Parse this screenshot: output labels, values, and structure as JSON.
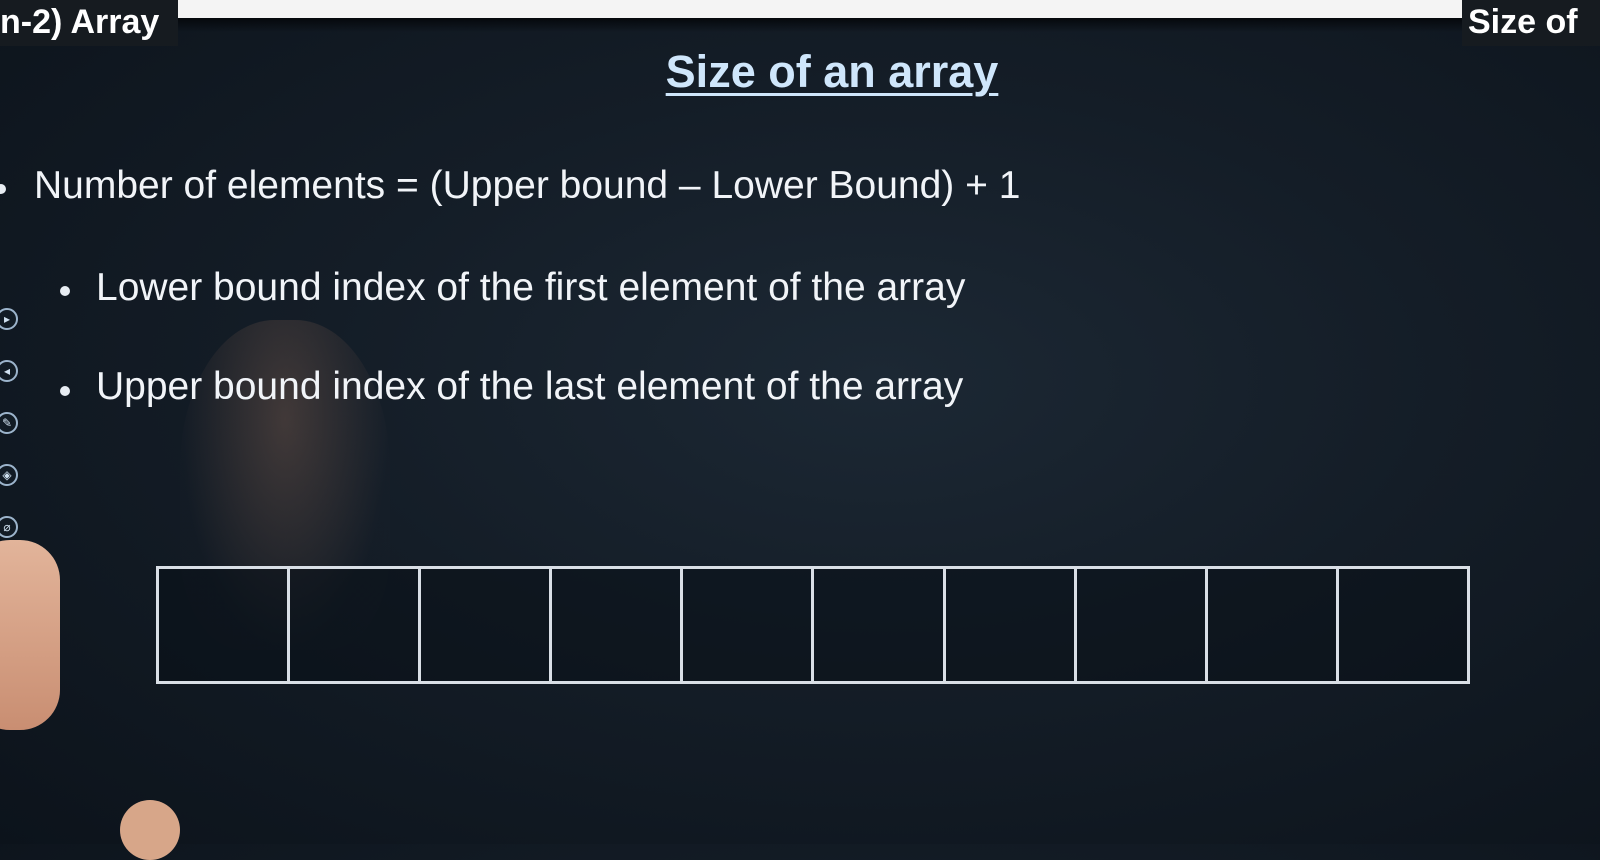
{
  "captions": {
    "left": "n-2) Array",
    "right": "Size of"
  },
  "slide": {
    "title": "Size of an array",
    "bullets": [
      "Number of elements = (Upper bound – Lower Bound) + 1",
      "Lower bound index of the first element of the array",
      "Upper bound index of the last element of the array"
    ]
  },
  "toolbar": {
    "icons": [
      "play-next-icon",
      "play-prev-icon",
      "pen-icon",
      "highlighter-icon",
      "eraser-icon",
      "zoom-icon"
    ]
  },
  "array_diagram": {
    "cell_count": 10
  }
}
